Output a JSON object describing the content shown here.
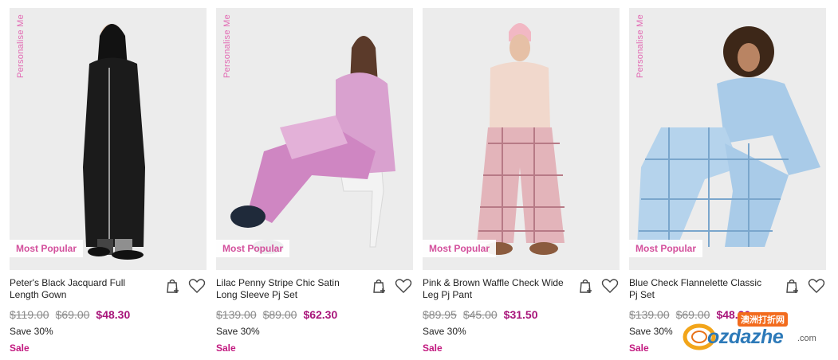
{
  "products": [
    {
      "personalise": "Personalise Me",
      "badge": "Most Popular",
      "name": "Peter's Black Jacquard Full Length Gown",
      "price_rrp": "$119.00",
      "price_was": "$69.00",
      "price_now": "$48.30",
      "save": "Save 30%",
      "sale": "Sale",
      "garment_color": "#1b1b1b",
      "bg_color": "#ececec"
    },
    {
      "personalise": "Personalise Me",
      "badge": "Most Popular",
      "name": "Lilac Penny Stripe Chic Satin Long Sleeve Pj Set",
      "price_rrp": "$139.00",
      "price_was": "$89.00",
      "price_now": "$62.30",
      "save": "Save 30%",
      "sale": "Sale",
      "garment_color": "#d9a1cf",
      "bg_color": "#ececec"
    },
    {
      "personalise": "",
      "badge": "Most Popular",
      "name": "Pink & Brown Waffle Check Wide Leg Pj Pant",
      "price_rrp": "$89.95",
      "price_was": "$45.00",
      "price_now": "$31.50",
      "save": "Save 30%",
      "sale": "Sale",
      "garment_color": "#e3b4ba",
      "bg_color": "#ececec"
    },
    {
      "personalise": "Personalise Me",
      "badge": "Most Popular",
      "name": "Blue Check Flannelette Classic Pj Set",
      "price_rrp": "$139.00",
      "price_was": "$69.00",
      "price_now": "$48.30",
      "save": "Save 30%",
      "sale": "Sale",
      "garment_color": "#a9cbe8",
      "bg_color": "#ececec"
    }
  ],
  "watermark": {
    "brand": "ozdazhe",
    "suffix": ".com",
    "chinese": "澳洲打折网"
  },
  "colors": {
    "accent_pink": "#d34f9c",
    "sale_price": "#a8157a"
  }
}
